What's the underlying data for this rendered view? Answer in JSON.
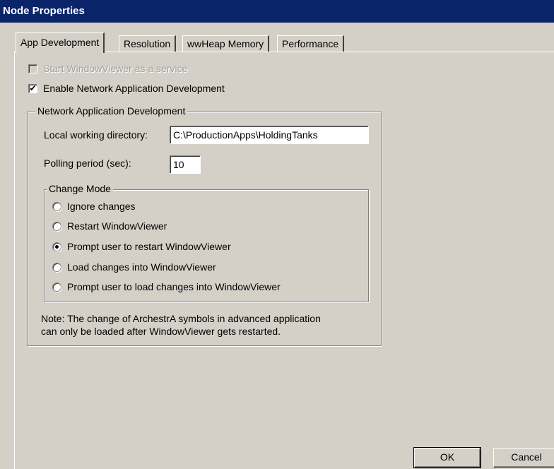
{
  "window": {
    "title": "Node Properties"
  },
  "tabs": [
    {
      "label": "App Development",
      "active": true
    },
    {
      "label": "Resolution",
      "active": false
    },
    {
      "label": "wwHeap Memory",
      "active": false
    },
    {
      "label": "Performance",
      "active": false
    }
  ],
  "options": {
    "start_service": {
      "label": "Start WindowViewer as a service",
      "checked": false,
      "enabled": false
    },
    "enable_network_dev": {
      "label": "Enable Network Application Development",
      "checked": true,
      "enabled": true
    }
  },
  "network_group": {
    "legend": "Network Application Development",
    "local_dir_label": "Local working directory:",
    "local_dir_value": "C:\\ProductionApps\\HoldingTanks",
    "polling_label": "Polling period (sec):",
    "polling_value": "10"
  },
  "change_mode": {
    "legend": "Change Mode",
    "options": [
      {
        "label": "Ignore changes",
        "selected": false
      },
      {
        "label": "Restart WindowViewer",
        "selected": false
      },
      {
        "label": "Prompt user to restart WindowViewer",
        "selected": true
      },
      {
        "label": "Load changes into WindowViewer",
        "selected": false
      },
      {
        "label": "Prompt user to load changes into WindowViewer",
        "selected": false
      }
    ]
  },
  "note": {
    "line1": "Note: The change of ArchestrA symbols in advanced application",
    "line2": "can only be loaded after WindowViewer gets restarted."
  },
  "buttons": {
    "ok": "OK",
    "cancel": "Cancel"
  }
}
